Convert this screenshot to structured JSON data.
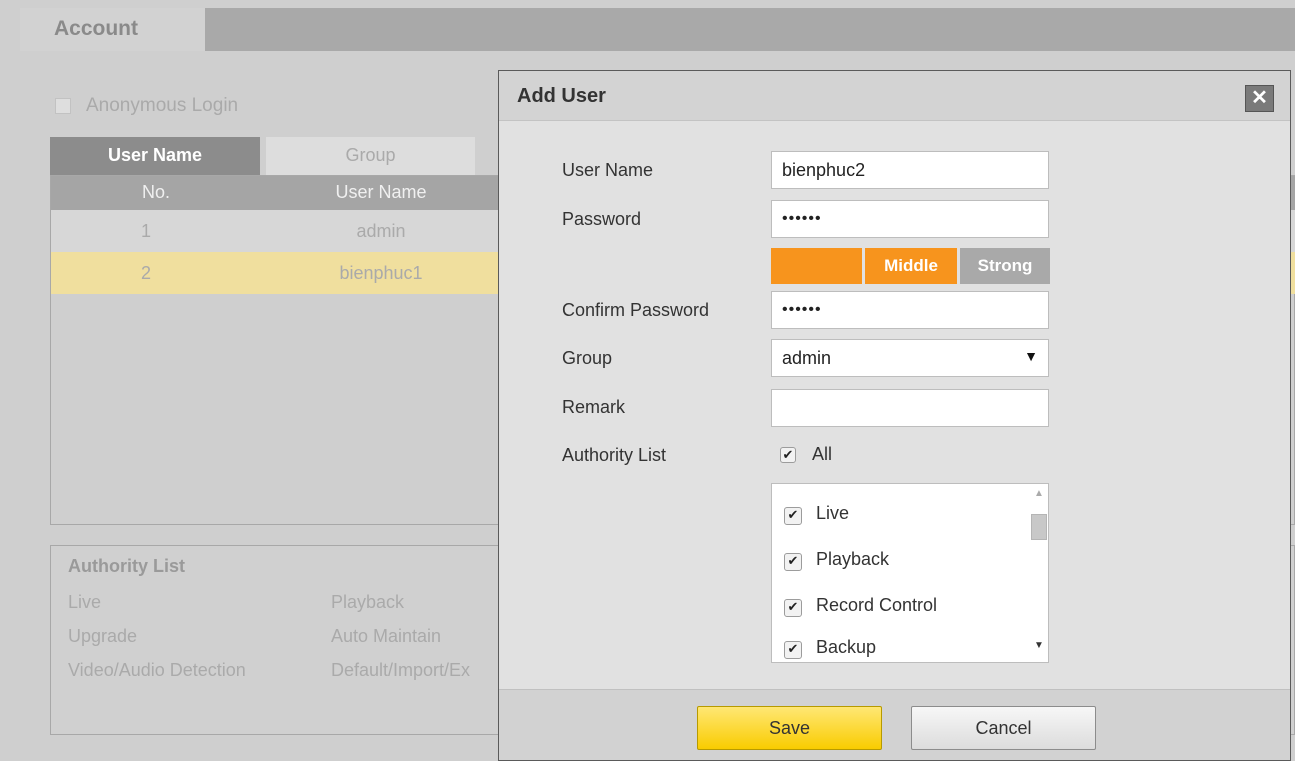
{
  "background": {
    "tab_account": "Account",
    "anonymous_login": "Anonymous Login",
    "tabs": [
      "User Name",
      "Group"
    ],
    "table": {
      "headers": [
        "No.",
        "User Name"
      ],
      "rows": [
        {
          "no": "1",
          "name": "admin"
        },
        {
          "no": "2",
          "name": "bienphuc1"
        }
      ]
    },
    "authority_panel": {
      "title": "Authority List",
      "items": [
        "Live",
        "Playback",
        "Upgrade",
        "Auto Maintain",
        "Video/Audio Detection",
        "Default/Import/Ex"
      ]
    }
  },
  "dialog": {
    "title": "Add User",
    "close_icon": "close-icon",
    "labels": {
      "username": "User Name",
      "password": "Password",
      "confirm": "Confirm Password",
      "group": "Group",
      "remark": "Remark",
      "authority": "Authority List"
    },
    "values": {
      "username": "bienphuc2",
      "password": "••••••",
      "confirm": "••••••",
      "group": "admin",
      "remark": ""
    },
    "strength": {
      "middle": "Middle",
      "strong": "Strong",
      "level": "Middle"
    },
    "all_label": "All",
    "authority_items": [
      "Live",
      "Playback",
      "Record Control",
      "Backup"
    ],
    "buttons": {
      "save": "Save",
      "cancel": "Cancel"
    }
  },
  "colors": {
    "strength_active": "#f7941d",
    "selected_row": "#f0df9e",
    "save_button": "#fbd624"
  }
}
